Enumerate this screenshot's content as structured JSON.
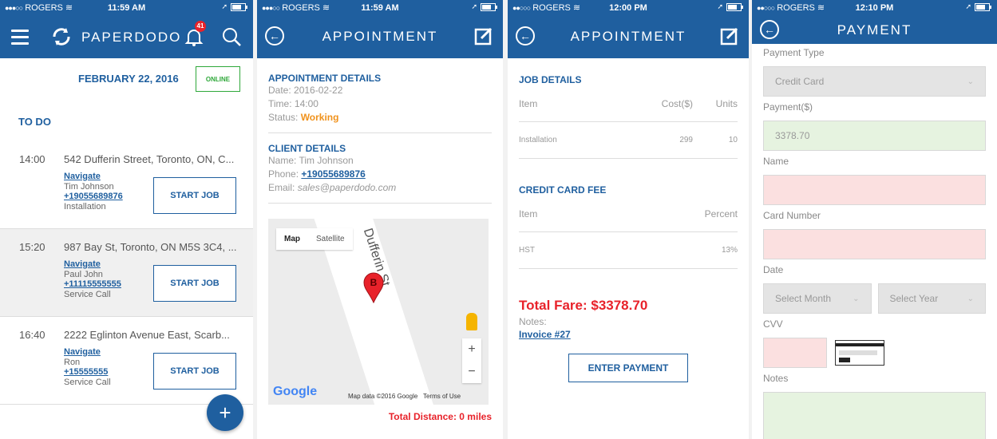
{
  "colors": {
    "brand": "#1f5f9f",
    "accent_red": "#e8222a",
    "status_working": "#f0921c",
    "online_green": "#2fa83a"
  },
  "status_bar": [
    {
      "carrier": "ROGERS",
      "time": "11:59 AM"
    },
    {
      "carrier": "ROGERS",
      "time": "11:59 AM"
    },
    {
      "carrier": "ROGERS",
      "time": "12:00 PM"
    },
    {
      "carrier": "ROGERS",
      "time": "12:10 PM"
    }
  ],
  "home": {
    "brand": "PAPERDODO",
    "notification_count": "41",
    "date": "FEBRUARY 22, 2016",
    "online_label": "ONLINE",
    "todo_label": "TO DO",
    "jobs": [
      {
        "time": "14:00",
        "address": "542 Dufferin Street, Toronto, ON, C...",
        "navigate": "Navigate",
        "name": "Tim Johnson",
        "phone": "+19055689876",
        "type": "Installation",
        "button": "START JOB"
      },
      {
        "time": "15:20",
        "address": "987 Bay St, Toronto, ON M5S 3C4, ...",
        "navigate": "Navigate",
        "name": "Paul John",
        "phone": "+11115555555",
        "type": "Service Call",
        "button": "START JOB"
      },
      {
        "time": "16:40",
        "address": "2222 Eglinton Avenue East, Scarb...",
        "navigate": "Navigate",
        "name": "Ron",
        "phone": "+15555555",
        "type": "Service Call",
        "button": "START JOB"
      }
    ],
    "fab_label": "+"
  },
  "appointment": {
    "title": "APPOINTMENT",
    "details_heading": "APPOINTMENT DETAILS",
    "date_line": "Date: 2016-02-22",
    "time_line": "Time: 14:00",
    "status_label": "Status: ",
    "status_value": "Working",
    "client_heading": "CLIENT DETAILS",
    "name_line": "Name: Tim Johnson",
    "phone_label": "Phone: ",
    "phone_value": "+19055689876",
    "email_label": "Email: ",
    "email_value": "sales@paperdodo.com",
    "map": {
      "toggle_map": "Map",
      "toggle_satellite": "Satellite",
      "street": "Dufferin St",
      "marker": "B",
      "zoom_in": "+",
      "zoom_out": "−",
      "logo": "Google",
      "copyright": "Map data ©2016 Google",
      "terms": "Terms of Use"
    },
    "total_distance": "Total Distance: 0 miles"
  },
  "invoice": {
    "title": "APPOINTMENT",
    "job_heading": "JOB DETAILS",
    "job_columns": [
      "Item",
      "Cost($)",
      "Units"
    ],
    "job_rows": [
      [
        "Installation",
        "299",
        "10"
      ]
    ],
    "fee_heading": "CREDIT CARD FEE",
    "fee_columns": [
      "Item",
      "Percent"
    ],
    "fee_rows": [
      [
        "HST",
        "13%"
      ]
    ],
    "total_fare": "Total Fare: $3378.70",
    "notes_label": "Notes:",
    "invoice_link": "Invoice #27",
    "pay_button": "ENTER PAYMENT"
  },
  "payment": {
    "title": "PAYMENT",
    "payment_type_label": "Payment Type",
    "payment_type_value": "Credit Card",
    "amount_label": "Payment($)",
    "amount_value": "3378.70",
    "name_label": "Name",
    "card_number_label": "Card Number",
    "date_label": "Date",
    "month_placeholder": "Select Month",
    "year_placeholder": "Select Year",
    "cvv_label": "CVV",
    "notes_label": "Notes"
  }
}
